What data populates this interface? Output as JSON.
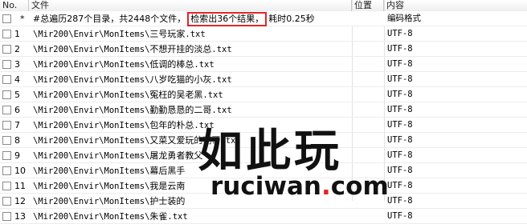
{
  "columns": {
    "no": "No.",
    "file": "文件",
    "position": "位置",
    "content": "内容"
  },
  "summary": {
    "marker": "*",
    "part1": "#总遍历287个目录，共2448个文件，",
    "highlight": "检索出36个结果，",
    "part2": "耗时0.25秒",
    "content": "编码格式"
  },
  "rows": [
    {
      "no": "1",
      "path": "\\Mir200\\Envir\\MonItems\\",
      "name": "三号玩家",
      "ext": ".txt",
      "content": "UTF-8"
    },
    {
      "no": "2",
      "path": "\\Mir200\\Envir\\MonItems\\",
      "name": "不想开挂的淡总",
      "ext": ".txt",
      "content": "UTF-8"
    },
    {
      "no": "3",
      "path": "\\Mir200\\Envir\\MonItems\\",
      "name": "低调的棒总",
      "ext": ".txt",
      "content": "UTF-8"
    },
    {
      "no": "4",
      "path": "\\Mir200\\Envir\\MonItems\\",
      "name": "八岁吃猫的小灰",
      "ext": ".txt",
      "content": "UTF-8"
    },
    {
      "no": "5",
      "path": "\\Mir200\\Envir\\MonItems\\",
      "name": "冤枉的吴老黑",
      "ext": ".txt",
      "content": "UTF-8"
    },
    {
      "no": "6",
      "path": "\\Mir200\\Envir\\MonItems\\",
      "name": "勤勤恳恳的二哥",
      "ext": ".txt",
      "content": "UTF-8"
    },
    {
      "no": "7",
      "path": "\\Mir200\\Envir\\MonItems\\",
      "name": "包年的朴总",
      "ext": ".txt",
      "content": "UTF-8"
    },
    {
      "no": "8",
      "path": "\\Mir200\\Envir\\MonItems\\",
      "name": "又菜又爱玩的明哥",
      "ext": ".txt",
      "content": "UTF-8"
    },
    {
      "no": "9",
      "path": "\\Mir200\\Envir\\MonItems\\",
      "name": "屠龙勇者教父",
      "ext": "",
      "content": "UTF-8"
    },
    {
      "no": "10",
      "path": "\\Mir200\\Envir\\MonItems\\",
      "name": "幕后黑手",
      "ext": "",
      "content": "UTF-8"
    },
    {
      "no": "11",
      "path": "\\Mir200\\Envir\\MonItems\\",
      "name": "我是云南",
      "ext": "",
      "content": "UTF-8"
    },
    {
      "no": "12",
      "path": "\\Mir200\\Envir\\MonItems\\",
      "name": "护士装的",
      "ext": "",
      "content": "UTF-8"
    },
    {
      "no": "13",
      "path": "\\Mir200\\Envir\\MonItems\\",
      "name": "朱雀",
      "ext": ".txt",
      "content": "UTF-8"
    }
  ],
  "watermark": {
    "title": "如此玩",
    "domain_left": "ruciwan",
    "domain_dot": ".",
    "domain_right": "com"
  }
}
